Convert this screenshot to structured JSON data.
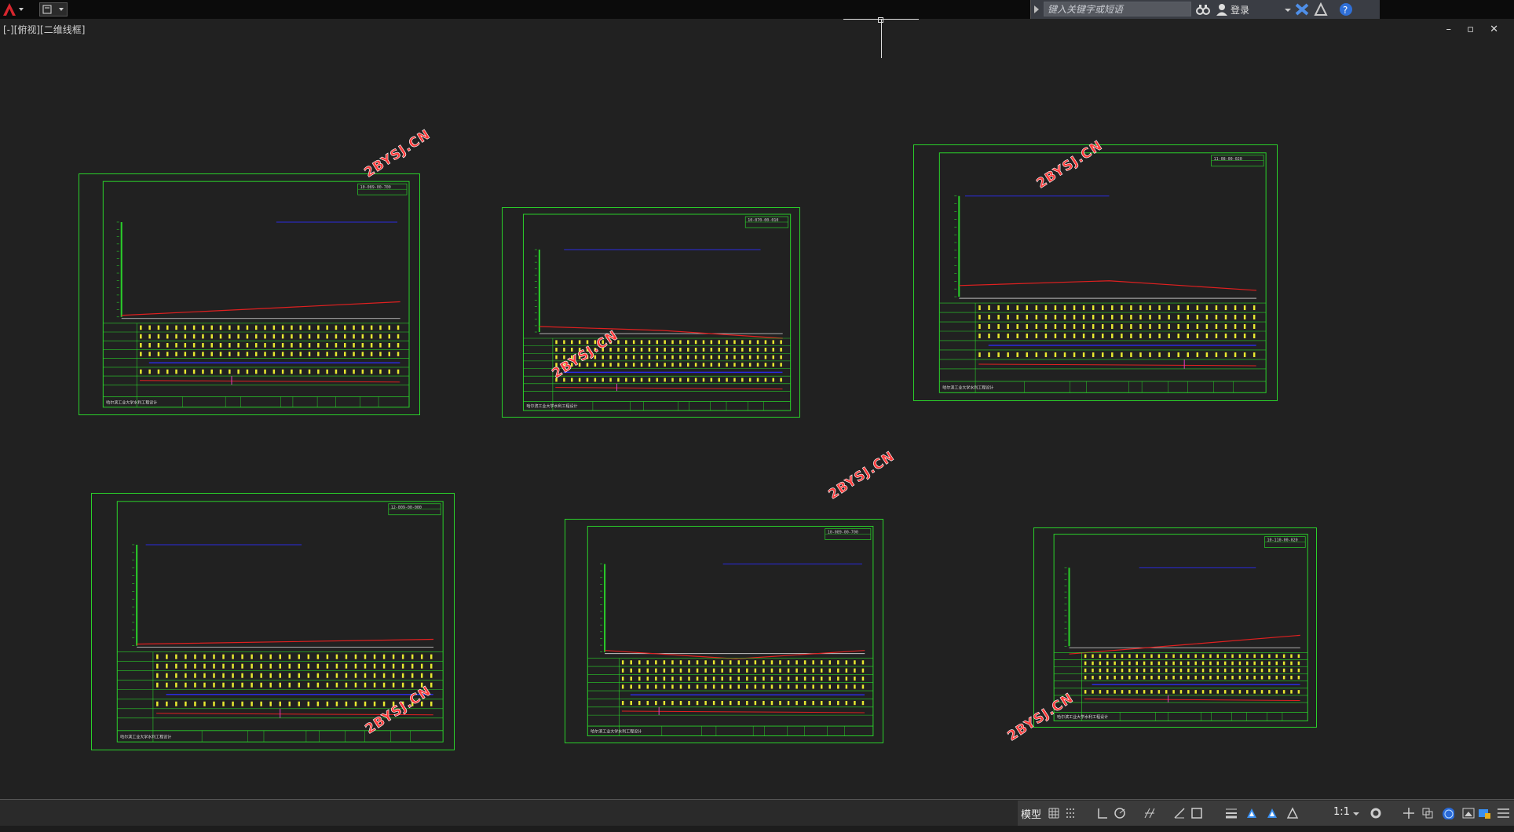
{
  "toolbar": {
    "search_placeholder": "键入关键字或短语",
    "login_label": "登录"
  },
  "viewport": {
    "label": "[-][俯视][二维线框]",
    "window_controls": "– ▫ ✕"
  },
  "watermark_text": "2BYSJ.CN",
  "sheets": [
    {
      "title_code": "10-089-00-700",
      "footer": "哈尔滨工业大学水利工程设计"
    },
    {
      "title_code": "10-070-00-010",
      "footer": "哈尔滨工业大学水利工程设计"
    },
    {
      "title_code": "11-08-00-020",
      "footer": "哈尔滨工业大学水利工程设计"
    },
    {
      "title_code": "12-009-00-000",
      "footer": "哈尔滨工业大学水利工程设计"
    },
    {
      "title_code": "10-089-00-700",
      "footer": "哈尔滨工业大学水利工程设计"
    },
    {
      "title_code": "10-110-00-020",
      "footer": "哈尔滨工业大学水利工程设计"
    }
  ],
  "statusbar": {
    "model_label": "模型",
    "scale_label": "1:1"
  },
  "colors": {
    "frame": "#2ad12a",
    "profile_red": "#e02020",
    "profile_blue": "#2a2ae0",
    "grid_yellow": "#e8e830",
    "background": "#212121",
    "watermark": "#ff3a3a"
  }
}
